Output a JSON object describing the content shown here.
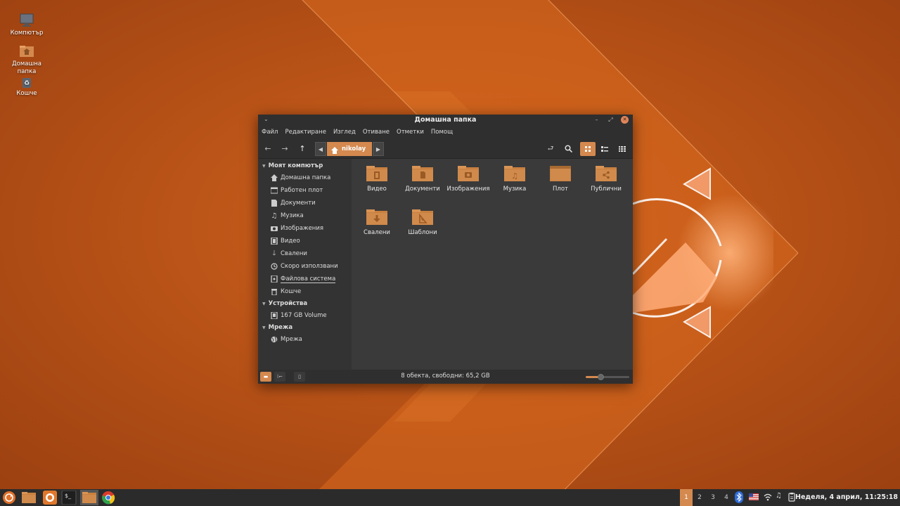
{
  "desktop": {
    "icons": [
      {
        "label": "Компютър"
      },
      {
        "label": "Домашна папка"
      },
      {
        "label": "Кошче"
      }
    ]
  },
  "window": {
    "title": "Домашна папка",
    "menu": [
      "Файл",
      "Редактиране",
      "Изглед",
      "Отиване",
      "Отметки",
      "Помощ"
    ],
    "path": {
      "current": "nikolay"
    },
    "sidebar": {
      "sections": [
        {
          "title": "Моят компютър",
          "items": [
            "Домашна папка",
            "Работен плот",
            "Документи",
            "Музика",
            "Изображения",
            "Видео",
            "Свалени",
            "Скоро използвани",
            "Файлова система",
            "Кошче"
          ]
        },
        {
          "title": "Устройства",
          "items": [
            "167 GB Volume"
          ]
        },
        {
          "title": "Мрежа",
          "items": [
            "Мрежа"
          ]
        }
      ]
    },
    "files": [
      {
        "name": "Видео",
        "icon": "video-icon"
      },
      {
        "name": "Документи",
        "icon": "document-icon"
      },
      {
        "name": "Изображения",
        "icon": "camera-icon"
      },
      {
        "name": "Музика",
        "icon": "music-icon"
      },
      {
        "name": "Плот",
        "icon": "desktop-icon"
      },
      {
        "name": "Публични",
        "icon": "share-icon"
      },
      {
        "name": "Свалени",
        "icon": "download-icon"
      },
      {
        "name": "Шаблони",
        "icon": "template-icon"
      }
    ],
    "status": "8 обекта, свободни: 65,2 GB",
    "zoom_level": 0.35
  },
  "taskbar": {
    "workspaces": [
      "1",
      "2",
      "3",
      "4"
    ],
    "active_workspace": "1",
    "clock": "Неделя,  4 април, 11:25:18"
  },
  "colors": {
    "accent": "#d4894f",
    "wallpaper": "#c2561a",
    "panel": "#2b2b2b"
  }
}
